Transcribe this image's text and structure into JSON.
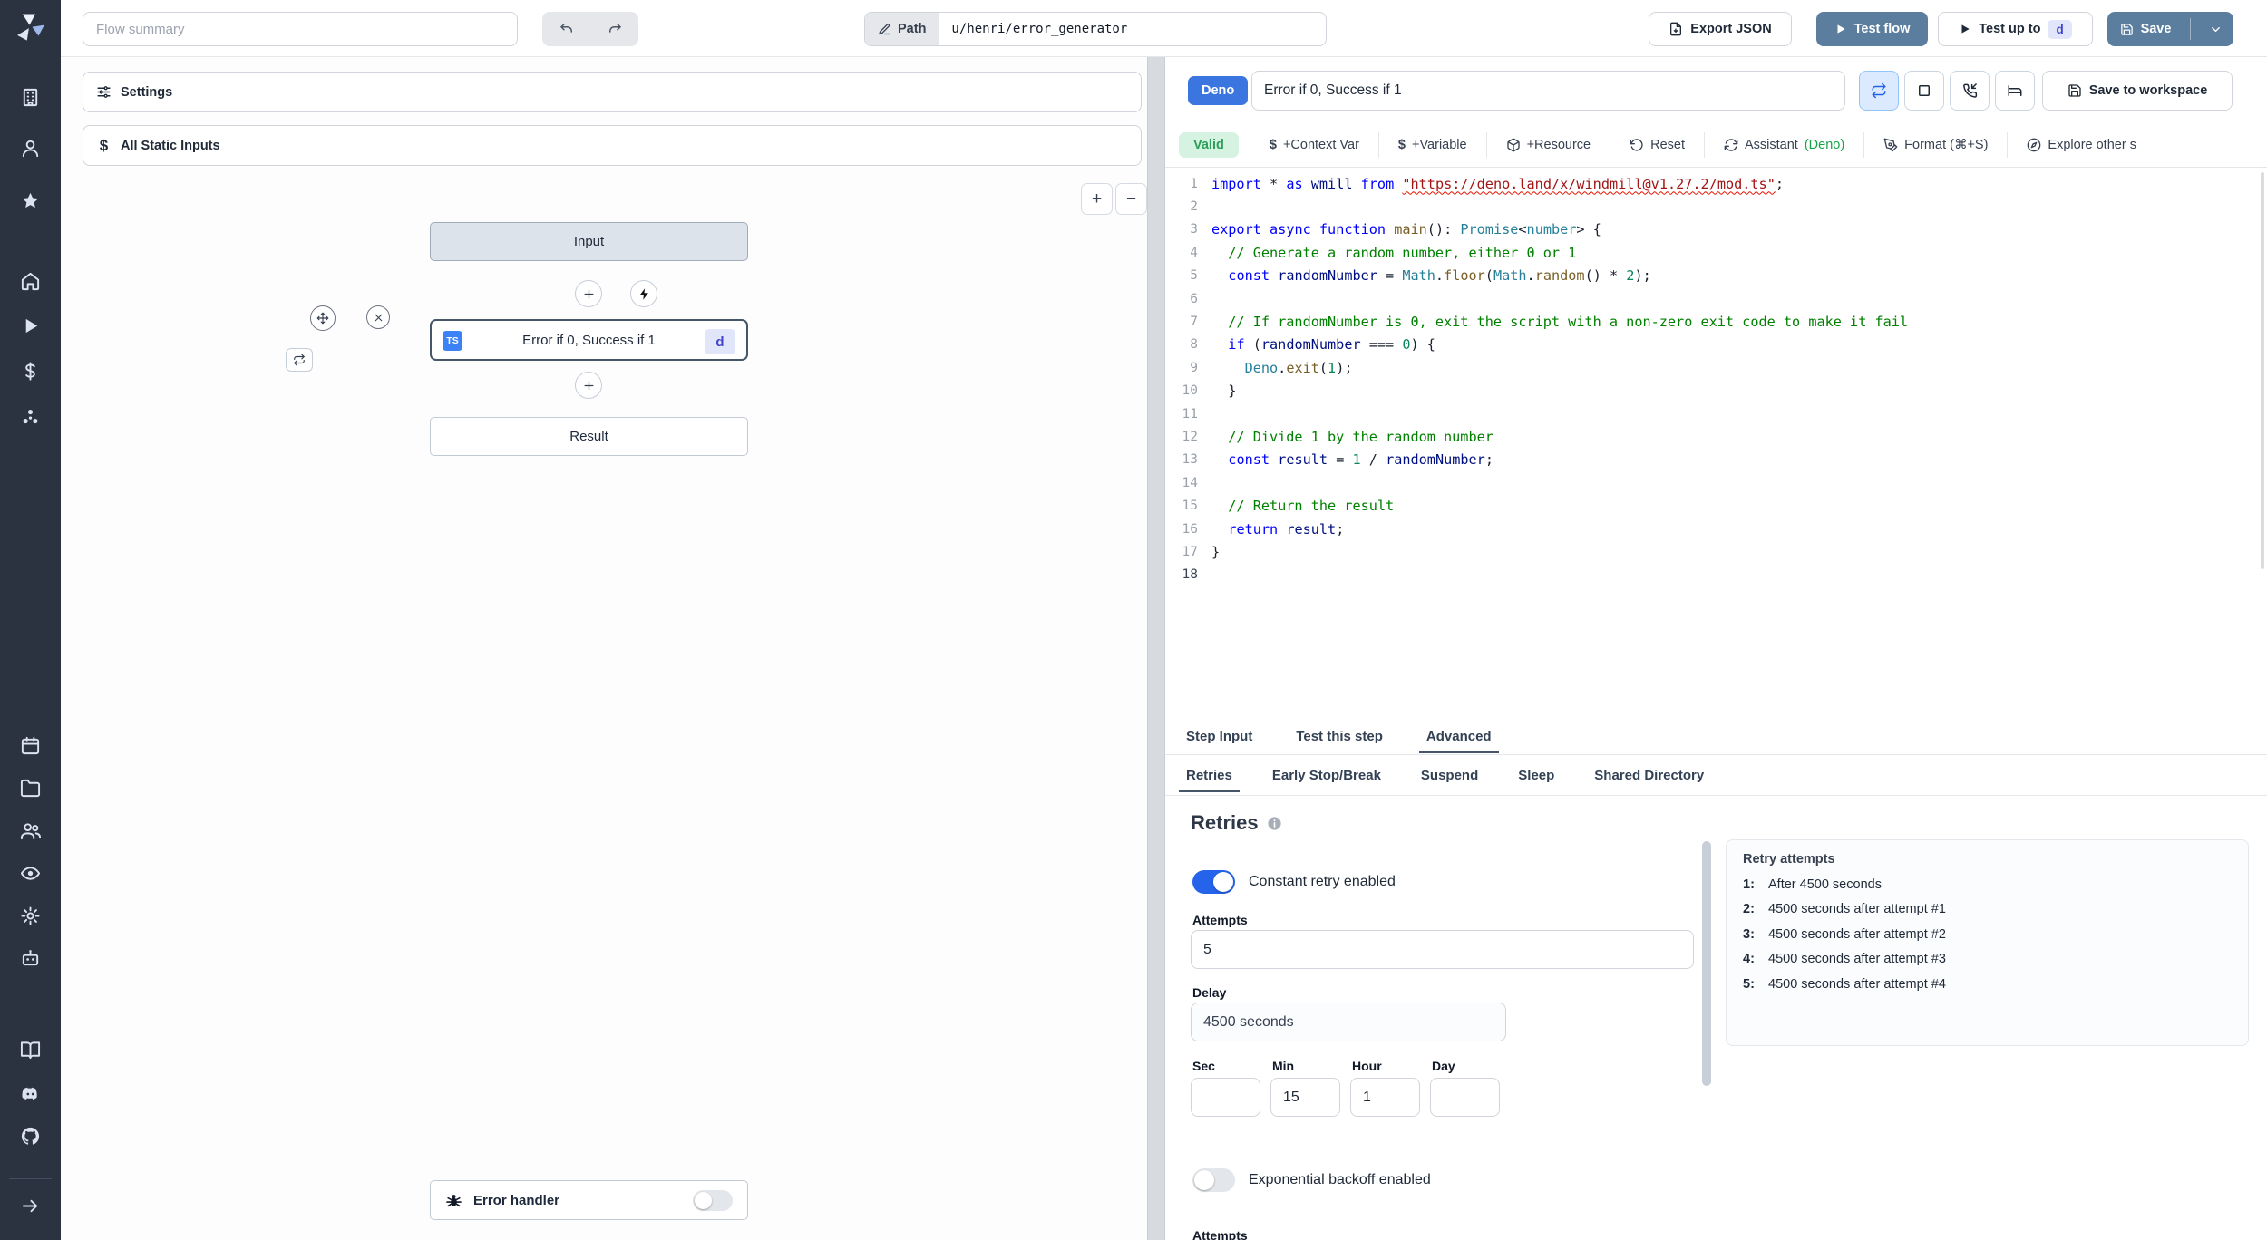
{
  "app": {
    "name": "Windmill flow editor"
  },
  "topbar": {
    "flow_summary_placeholder": "Flow summary",
    "path_label": "Path",
    "path_value": "u/henri/error_generator",
    "export_json_label": "Export JSON",
    "test_flow_label": "Test flow",
    "test_up_to_label": "Test up to",
    "test_up_to_badge": "d",
    "save_label": "Save"
  },
  "sidebar": {
    "icons": [
      "building",
      "user",
      "star",
      "home",
      "play",
      "dollar",
      "resources",
      "calendar",
      "folder",
      "users",
      "eye",
      "gear",
      "robot",
      "book",
      "discord",
      "github",
      "arrow-right"
    ]
  },
  "left_panel": {
    "settings_label": "Settings",
    "static_inputs_label": "All Static Inputs",
    "zoom_in_label": "+",
    "zoom_out_label": "−",
    "graph": {
      "input_label": "Input",
      "step_lang_badge": "TS",
      "step_title": "Error if 0, Success if 1",
      "step_id_badge": "d",
      "result_label": "Result",
      "error_handler_label": "Error handler"
    }
  },
  "step_panel": {
    "lang_badge": "Deno",
    "name_value": "Error if 0, Success if 1",
    "save_to_workspace_label": "Save to workspace",
    "toolbar": {
      "valid_label": "Valid",
      "context_var_label": "+Context Var",
      "variable_label": "+Variable",
      "resource_label": "+Resource",
      "reset_label": "Reset",
      "assistant_label": "Assistant",
      "assistant_lang": "(Deno)",
      "format_label": "Format (⌘+S)",
      "explore_label": "Explore other s"
    },
    "tabs": [
      "Step Input",
      "Test this step",
      "Advanced"
    ],
    "active_tab": "Advanced",
    "subtabs": [
      "Retries",
      "Early Stop/Break",
      "Suspend",
      "Sleep",
      "Shared Directory"
    ],
    "active_subtab": "Retries"
  },
  "editor": {
    "current_line": 18,
    "lines": [
      [
        [
          "k",
          "import"
        ],
        [
          "p",
          " * "
        ],
        [
          "k",
          "as"
        ],
        [
          "p",
          " "
        ],
        [
          "v",
          "wmill"
        ],
        [
          "p",
          " "
        ],
        [
          "k",
          "from"
        ],
        [
          "p",
          " "
        ],
        [
          "u",
          "\"https://deno.land/x/windmill@v1.27.2/mod.ts\""
        ],
        [
          "p",
          ";"
        ]
      ],
      [],
      [
        [
          "k",
          "export"
        ],
        [
          "p",
          " "
        ],
        [
          "k",
          "async"
        ],
        [
          "p",
          " "
        ],
        [
          "k",
          "function"
        ],
        [
          "p",
          " "
        ],
        [
          "f",
          "main"
        ],
        [
          "p",
          "(): "
        ],
        [
          "t",
          "Promise"
        ],
        [
          "p",
          "<"
        ],
        [
          "t",
          "number"
        ],
        [
          "p",
          "> {"
        ]
      ],
      [
        [
          "c",
          "  // Generate a random number, either 0 or 1"
        ]
      ],
      [
        [
          "p",
          "  "
        ],
        [
          "k",
          "const"
        ],
        [
          "p",
          " "
        ],
        [
          "v",
          "randomNumber"
        ],
        [
          "p",
          " = "
        ],
        [
          "t",
          "Math"
        ],
        [
          "p",
          "."
        ],
        [
          "f",
          "floor"
        ],
        [
          "p",
          "("
        ],
        [
          "t",
          "Math"
        ],
        [
          "p",
          "."
        ],
        [
          "f",
          "random"
        ],
        [
          "p",
          "() * "
        ],
        [
          "n",
          "2"
        ],
        [
          "p",
          ");"
        ]
      ],
      [],
      [
        [
          "c",
          "  // If randomNumber is 0, exit the script with a non-zero exit code to make it fail"
        ]
      ],
      [
        [
          "p",
          "  "
        ],
        [
          "k",
          "if"
        ],
        [
          "p",
          " ("
        ],
        [
          "v",
          "randomNumber"
        ],
        [
          "p",
          " === "
        ],
        [
          "n",
          "0"
        ],
        [
          "p",
          ") {"
        ]
      ],
      [
        [
          "p",
          "    "
        ],
        [
          "t",
          "Deno"
        ],
        [
          "p",
          "."
        ],
        [
          "f",
          "exit"
        ],
        [
          "p",
          "("
        ],
        [
          "n",
          "1"
        ],
        [
          "p",
          ");"
        ]
      ],
      [
        [
          "p",
          "  }"
        ]
      ],
      [],
      [
        [
          "c",
          "  // Divide 1 by the random number"
        ]
      ],
      [
        [
          "p",
          "  "
        ],
        [
          "k",
          "const"
        ],
        [
          "p",
          " "
        ],
        [
          "v",
          "result"
        ],
        [
          "p",
          " = "
        ],
        [
          "n",
          "1"
        ],
        [
          "p",
          " / "
        ],
        [
          "v",
          "randomNumber"
        ],
        [
          "p",
          ";"
        ]
      ],
      [],
      [
        [
          "c",
          "  // Return the result"
        ]
      ],
      [
        [
          "p",
          "  "
        ],
        [
          "k",
          "return"
        ],
        [
          "p",
          " "
        ],
        [
          "v",
          "result"
        ],
        [
          "p",
          ";"
        ]
      ],
      [
        [
          "p",
          "}"
        ]
      ],
      []
    ]
  },
  "retries": {
    "title": "Retries",
    "constant_toggle_label": "Constant retry enabled",
    "constant_enabled": true,
    "attempts_label": "Attempts",
    "attempts_value": "5",
    "delay_label": "Delay",
    "delay_value": "4500 seconds",
    "time_fields": [
      {
        "label": "Sec",
        "value": ""
      },
      {
        "label": "Min",
        "value": "15"
      },
      {
        "label": "Hour",
        "value": "1"
      },
      {
        "label": "Day",
        "value": ""
      }
    ],
    "exponential_toggle_label": "Exponential backoff enabled",
    "exponential_enabled": false,
    "next_section_label": "Attempts",
    "attempts_panel": {
      "title": "Retry attempts",
      "items": [
        {
          "n": "1:",
          "text": "After 4500 seconds"
        },
        {
          "n": "2:",
          "text": "4500 seconds after attempt #1"
        },
        {
          "n": "3:",
          "text": "4500 seconds after attempt #2"
        },
        {
          "n": "4:",
          "text": "4500 seconds after attempt #3"
        },
        {
          "n": "5:",
          "text": "4500 seconds after attempt #4"
        }
      ]
    }
  },
  "colors": {
    "primary_button": "#5b7e9f",
    "deno_badge": "#3b76e0",
    "ts_badge": "#3b82f6",
    "toggle_on": "#2563eb",
    "valid_bg": "#d6f2e0",
    "valid_text": "#2f9e5c",
    "sidebar_bg": "#2b3240"
  }
}
